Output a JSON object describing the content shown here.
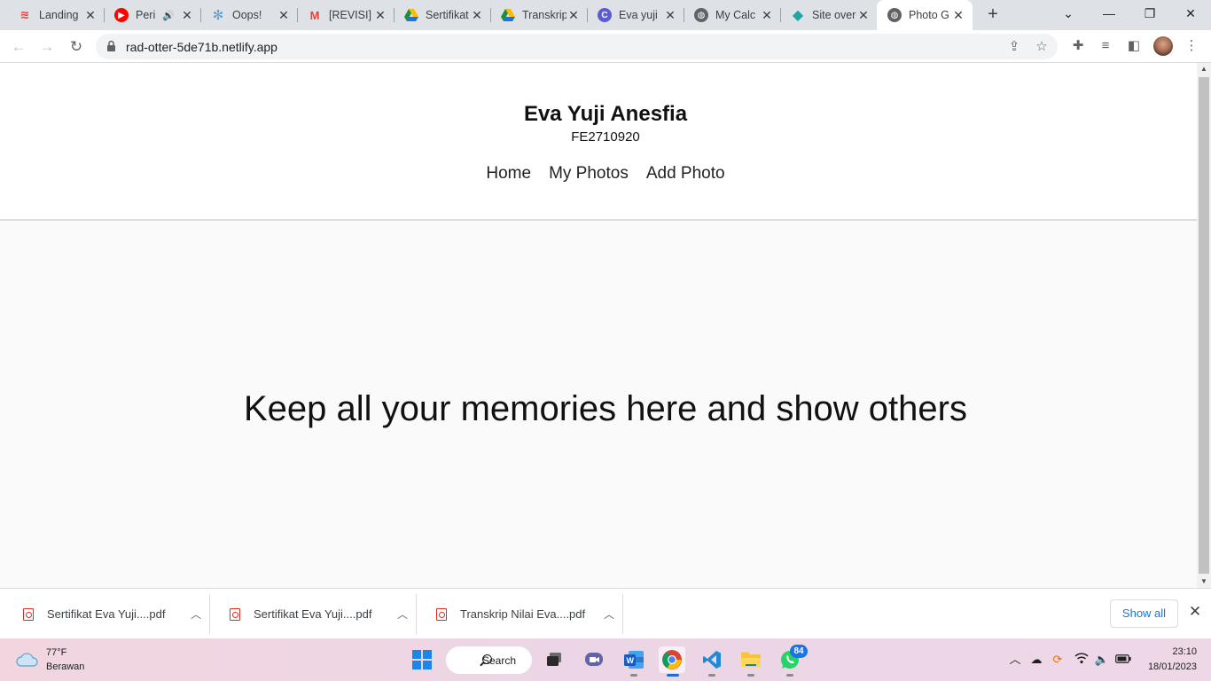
{
  "browser": {
    "tabs": [
      {
        "title": "Landing",
        "icon": "wifi-red-icon",
        "color": "#e8453c"
      },
      {
        "title": "Peri",
        "icon": "youtube-icon",
        "color": "#ff0000",
        "audio": "🔊"
      },
      {
        "title": "Oops!",
        "icon": "react-gear-icon",
        "color": "#5a9fd4"
      },
      {
        "title": "[REVISI]",
        "icon": "gmail-icon",
        "color": "#ea4335"
      },
      {
        "title": "Sertifikat",
        "icon": "google-drive-icon",
        "color": "#34a853"
      },
      {
        "title": "Transkrip",
        "icon": "google-drive-icon",
        "color": "#34a853"
      },
      {
        "title": "Eva yuji",
        "icon": "canva-icon",
        "color": "#5b5bd6"
      },
      {
        "title": "My Calc",
        "icon": "globe-icon",
        "color": "#5f6368"
      },
      {
        "title": "Site over",
        "icon": "netlify-icon",
        "color": "#20a5a5"
      },
      {
        "title": "Photo G",
        "icon": "globe-icon",
        "color": "#5f6368",
        "active": true
      }
    ],
    "close_glyph": "✕",
    "new_tab_glyph": "+",
    "url": "rad-otter-5de71b.netlify.app"
  },
  "site": {
    "title": "Eva Yuji Anesfia",
    "subtitle": "FE2710920",
    "nav": [
      "Home",
      "My Photos",
      "Add Photo"
    ],
    "hero_text": "Keep all your memories here and show others"
  },
  "downloads": {
    "items": [
      "Sertifikat Eva Yuji....pdf",
      "Sertifikat Eva Yuji....pdf",
      "Transkrip Nilai Eva....pdf"
    ],
    "show_all": "Show all"
  },
  "taskbar": {
    "temperature": "77°F",
    "weather": "Berawan",
    "search_label": "Search",
    "whatsapp_badge": "84",
    "time": "23:10",
    "date": "18/01/2023"
  }
}
